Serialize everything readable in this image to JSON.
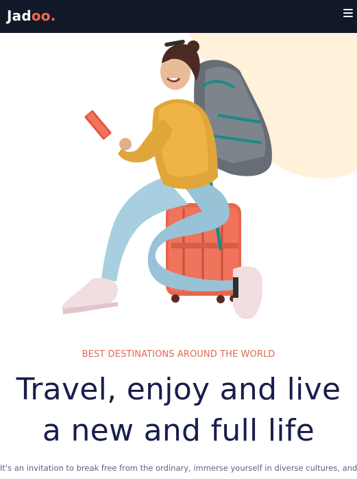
{
  "navbar": {
    "logo_main": "Jad",
    "logo_accent": "oo.",
    "menu_icon": "hamburger-menu-icon"
  },
  "hero": {
    "image_subject": "traveler-with-backpack-sitting-on-suitcase",
    "accent_blob_color": "#fff1da"
  },
  "content": {
    "tagline": "BEST DESTINATIONS AROUND THE WORLD",
    "headline_line1": "Travel, enjoy and live",
    "headline_line2": "a new and full life",
    "intro": "It's an invitation to break free from the ordinary, immerse yourself in diverse cultures, and"
  },
  "colors": {
    "navbar_bg": "#111827",
    "accent": "#df6951",
    "logo_accent": "#f26a4b",
    "heading": "#181e4b",
    "body_text": "#5e6282"
  }
}
